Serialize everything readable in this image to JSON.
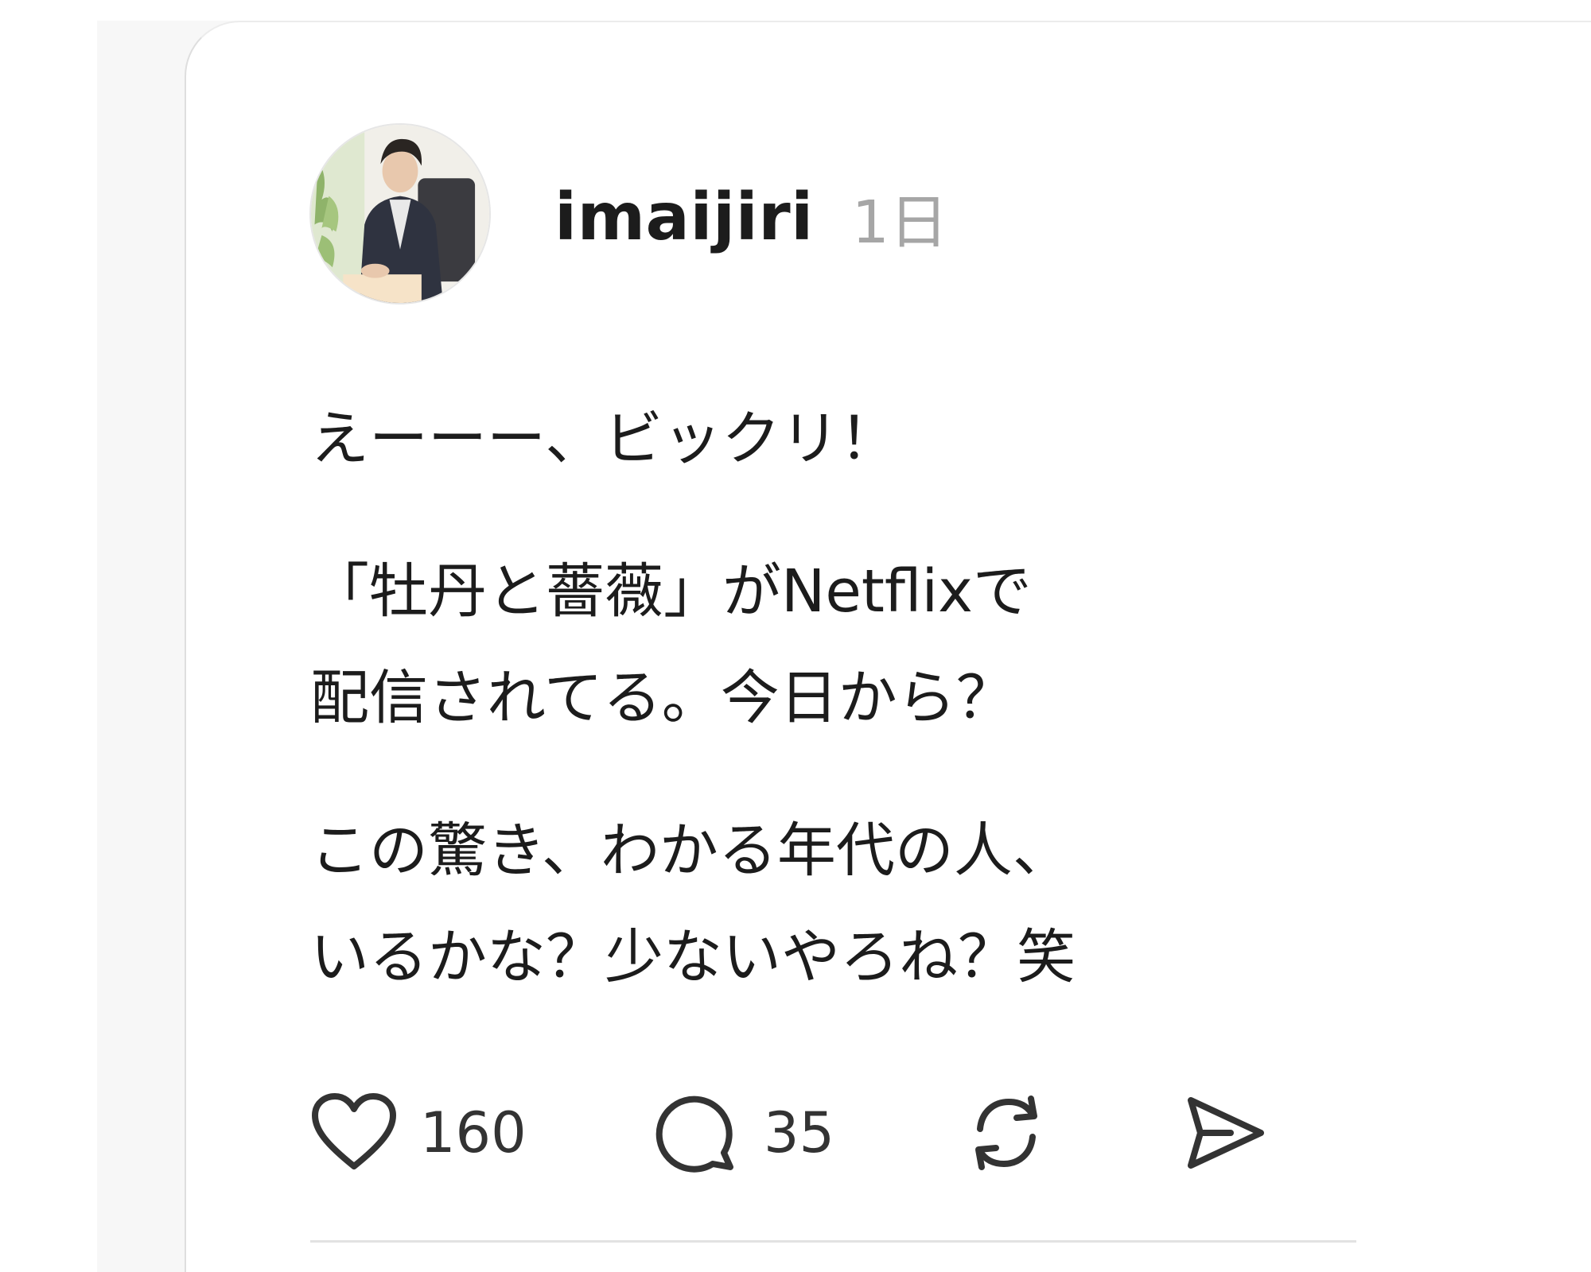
{
  "post": {
    "author": {
      "username": "imaijiri",
      "avatar_icon": "user-avatar-photo"
    },
    "timestamp": "1日",
    "body": {
      "paragraph_1": "えーーー、ビックリ！",
      "paragraph_2": "「牡丹と薔薇」がNetflixで\n配信されてる。今日から？",
      "paragraph_3": "この驚き、わかる年代の人、\nいるかな？少ないやろね？笑"
    },
    "actions": {
      "like": {
        "icon": "heart-icon",
        "count": "160"
      },
      "reply": {
        "icon": "comment-bubble-icon",
        "count": "35"
      },
      "repost": {
        "icon": "repost-icon"
      },
      "share": {
        "icon": "send-icon"
      }
    }
  },
  "colors": {
    "text": "#1c1c1c",
    "muted": "#a6a6a6",
    "icon": "#333333",
    "divider": "#e2e2e2",
    "background_strip": "#f7f7f7"
  }
}
